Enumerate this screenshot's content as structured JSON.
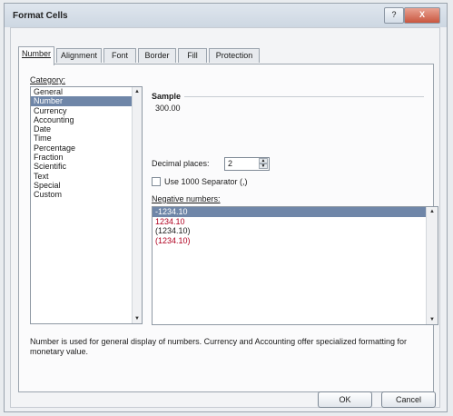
{
  "window": {
    "title": "Format Cells",
    "help_label": "?",
    "close_label": "X"
  },
  "tabs": [
    {
      "label": "Number"
    },
    {
      "label": "Alignment"
    },
    {
      "label": "Font"
    },
    {
      "label": "Border"
    },
    {
      "label": "Fill"
    },
    {
      "label": "Protection"
    }
  ],
  "category": {
    "label": "Category:",
    "items": [
      "General",
      "Number",
      "Currency",
      "Accounting",
      "Date",
      "Time",
      "Percentage",
      "Fraction",
      "Scientific",
      "Text",
      "Special",
      "Custom"
    ],
    "selected": "Number"
  },
  "sample": {
    "label": "Sample",
    "value": "300.00"
  },
  "decimal_places": {
    "label": "Decimal places:",
    "value": "2"
  },
  "use_separator": {
    "label": "Use 1000 Separator (,)",
    "checked": false
  },
  "negative_numbers": {
    "label": "Negative numbers:",
    "items": [
      "-1234.10",
      "1234.10",
      "(1234.10)",
      "(1234.10)"
    ],
    "selected_index": 0
  },
  "description": "Number is used for general display of numbers. Currency and Accounting offer specialized formatting for monetary value.",
  "buttons": {
    "ok": "OK",
    "cancel": "Cancel"
  },
  "icons": {
    "scroll_up": "scroll-up-arrow-icon",
    "scroll_down": "scroll-down-arrow-icon"
  },
  "colors": {
    "selection": "#6f86a8",
    "negative_red": "#b00020"
  }
}
